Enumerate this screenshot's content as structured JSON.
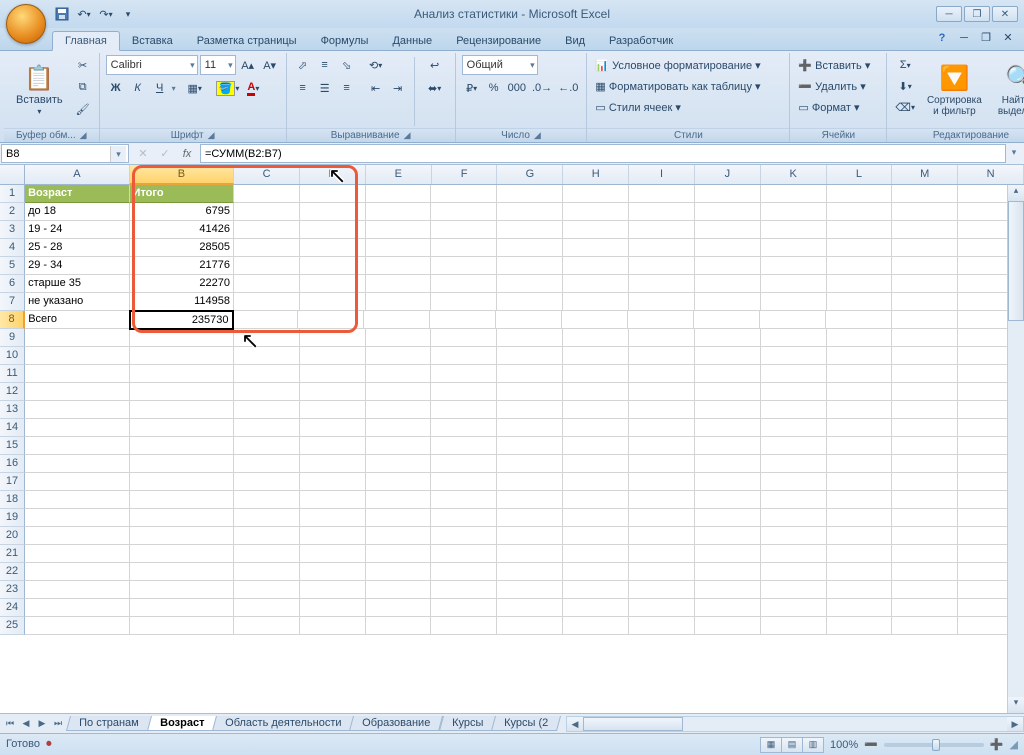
{
  "app": {
    "title": "Анализ статистики - Microsoft Excel"
  },
  "qat": {
    "save": "save",
    "undo": "undo",
    "redo": "redo"
  },
  "ribbonTabs": [
    "Главная",
    "Вставка",
    "Разметка страницы",
    "Формулы",
    "Данные",
    "Рецензирование",
    "Вид",
    "Разработчик"
  ],
  "activeTab": 0,
  "groups": {
    "clipboard": {
      "label": "Буфер обм...",
      "paste": "Вставить"
    },
    "font": {
      "label": "Шрифт",
      "name": "Calibri",
      "size": "11",
      "bold": "Ж",
      "italic": "К",
      "underline": "Ч"
    },
    "alignment": {
      "label": "Выравнивание"
    },
    "number": {
      "label": "Число",
      "format": "Общий"
    },
    "styles": {
      "label": "Стили",
      "condFmt": "Условное форматирование ▾",
      "fmtTable": "Форматировать как таблицу ▾",
      "cellStyles": "Стили ячеек ▾"
    },
    "cells": {
      "label": "Ячейки",
      "insert": "Вставить ▾",
      "delete": "Удалить ▾",
      "format": "Формат ▾"
    },
    "editing": {
      "label": "Редактирование",
      "sort": "Сортировка и фильтр",
      "find": "Найти и выделить"
    }
  },
  "nameBox": "B8",
  "formula": "=СУММ(B2:B7)",
  "columns": [
    "A",
    "B",
    "C",
    "D",
    "E",
    "F",
    "G",
    "H",
    "I",
    "J",
    "K",
    "L",
    "M",
    "N"
  ],
  "activeCol": "B",
  "activeRow": 8,
  "data": {
    "headers": {
      "A": "Возраст",
      "B": "Итого"
    },
    "rows": [
      {
        "A": "до 18",
        "B": "6795"
      },
      {
        "A": "19 - 24",
        "B": "41426"
      },
      {
        "A": "25 - 28",
        "B": "28505"
      },
      {
        "A": "29 - 34",
        "B": "21776"
      },
      {
        "A": "старше 35",
        "B": "22270"
      },
      {
        "A": "не указано",
        "B": "114958"
      },
      {
        "A": "Всего",
        "B": "235730"
      }
    ]
  },
  "sheetTabs": [
    "По странам",
    "Возраст",
    "Область деятельности",
    "Образование",
    "Курсы",
    "Курсы (2"
  ],
  "activeSheet": 1,
  "status": {
    "ready": "Готово",
    "zoom": "100%"
  }
}
